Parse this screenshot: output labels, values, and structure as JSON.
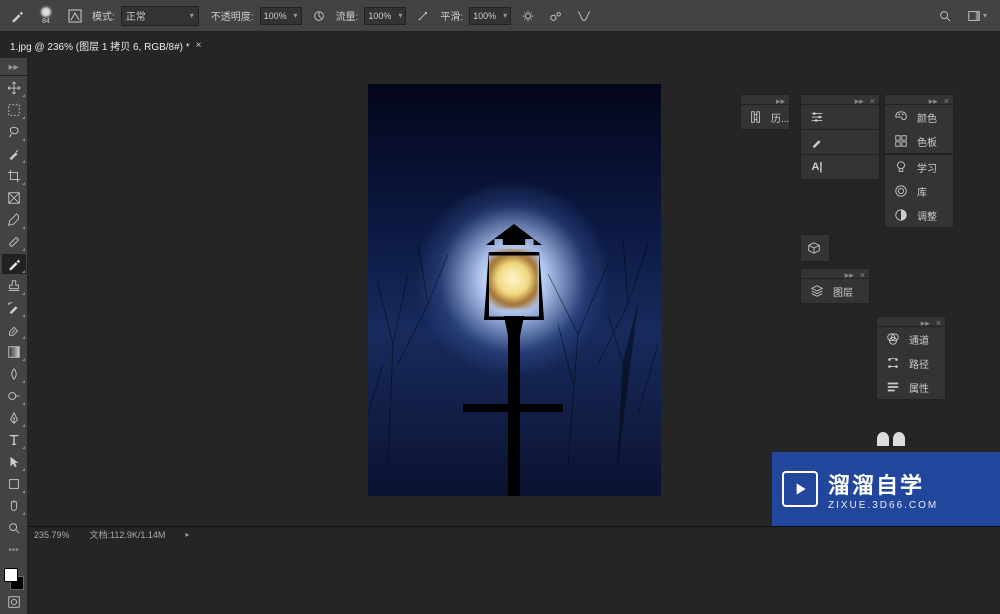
{
  "option_bar": {
    "brush_size": "84",
    "mode_label": "模式:",
    "mode_value": "正常",
    "opacity_label": "不透明度:",
    "opacity_value": "100%",
    "flow_label": "流量:",
    "flow_value": "100%",
    "smooth_label": "平滑:",
    "smooth_value": "100%"
  },
  "document": {
    "tab_title": "1.jpg @ 236% (图层 1 拷贝 6, RGB/8#) *"
  },
  "panels": {
    "history_label": "历...",
    "color_label": "颜色",
    "swatch_label": "色板",
    "learn_label": "学习",
    "library_label": "库",
    "adjust_label": "调整",
    "layers_label": "图层",
    "channels_label": "通道",
    "paths_label": "路径",
    "properties_label": "属性"
  },
  "status": {
    "zoom": "235.79%",
    "doc_info": "文档:112.9K/1.14M"
  },
  "watermark": {
    "main": "溜溜自学",
    "sub": "ZIXUE.3D66.COM"
  }
}
